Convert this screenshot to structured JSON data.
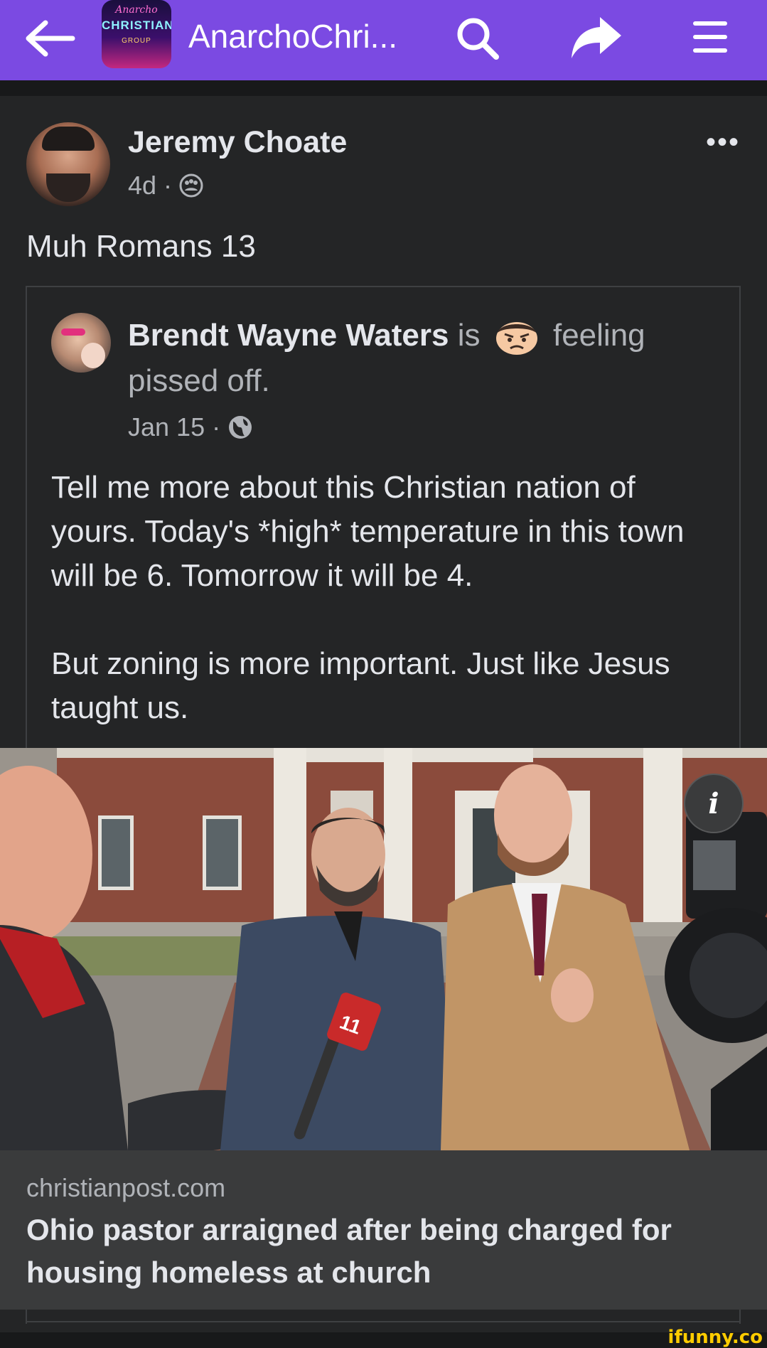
{
  "topbar": {
    "group_icon_lines": [
      "Anarcho",
      "CHRISTIAN",
      "GROUP"
    ],
    "title": "AnarchoChri...",
    "color": "#7b4ae2"
  },
  "post": {
    "author": "Jeremy Choate",
    "time": "4d",
    "audience_icon": "group-audience-icon",
    "text": "Muh Romans 13",
    "more_label": "•••"
  },
  "shared_post": {
    "author": "Brendt Wayne Waters",
    "is_word": "is",
    "feeling_emoji": "angry-face-emoji",
    "feeling_text": "feeling pissed off.",
    "time": "Jan 15",
    "audience_icon": "globe-icon",
    "paragraphs": [
      "Tell me more about this Christian nation of yours. Today's *high* temperature in this town will be 6. Tomorrow it will be 4.",
      "But zoning is more important. Just like Jesus taught us."
    ]
  },
  "link_preview": {
    "info_label": "i",
    "domain": "christianpost.com",
    "headline": "Ohio pastor arraigned after being charged for housing homeless at church",
    "mic_label": "11"
  },
  "watermark": "ifunny.co"
}
